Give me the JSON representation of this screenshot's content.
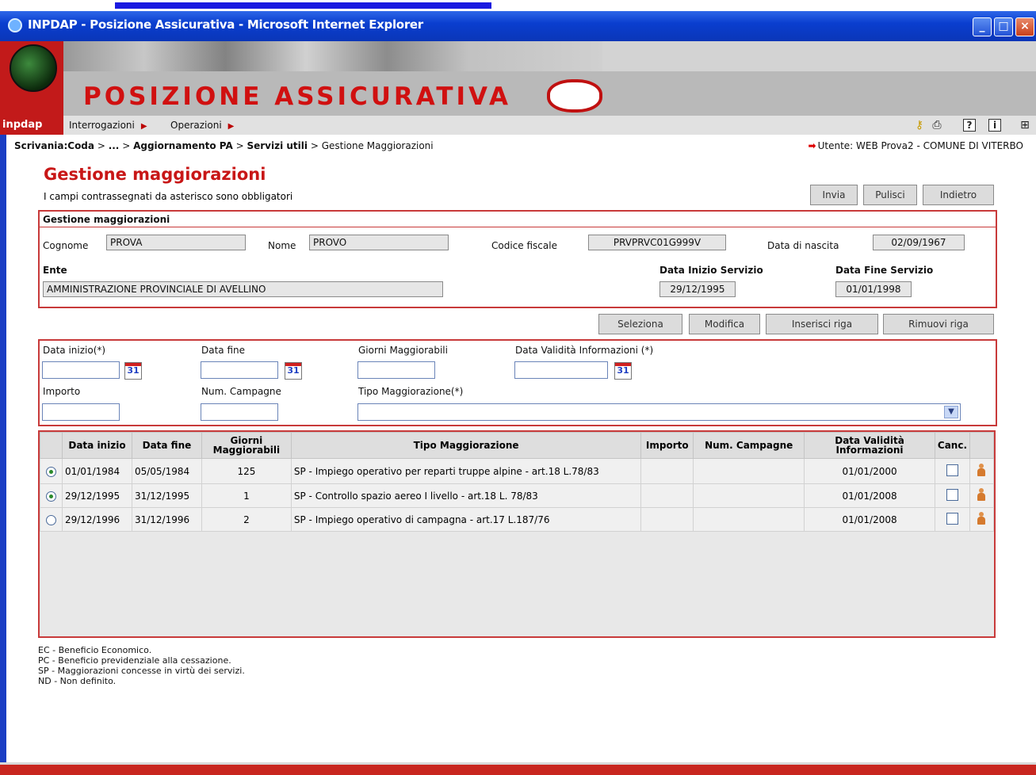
{
  "window": {
    "title": "INPDAP - Posizione Assicurativa - Microsoft Internet Explorer"
  },
  "banner": {
    "title": "POSIZIONE ASSICURATIVA",
    "logo_text": "inpdap"
  },
  "menu": {
    "items": [
      "Interrogazioni",
      "Operazioni"
    ]
  },
  "toolbar": {
    "icons": [
      "key-icon",
      "printer-icon",
      "help-icon",
      "info-icon",
      "sitemap-icon"
    ],
    "help": "?",
    "info": "i"
  },
  "breadcrumb": {
    "b1": "Scrivania:Coda",
    "sep": " > ",
    "b2": "...",
    "b3": "Aggiornamento PA",
    "b4": "Servizi utili",
    "b5": "Gestione Maggiorazioni"
  },
  "user": {
    "text": "Utente: WEB Prova2 - COMUNE DI VITERBO"
  },
  "page": {
    "title": "Gestione maggiorazioni",
    "subtitle": "I campi contrassegnati da asterisco sono obbligatori"
  },
  "actions": {
    "send": "Invia",
    "clear": "Pulisci",
    "back": "Indietro"
  },
  "anagrafica": {
    "section_title": "Gestione maggiorazioni",
    "cognome_label": "Cognome",
    "cognome": "PROVA",
    "nome_label": "Nome",
    "nome": "PROVO",
    "cf_label": "Codice fiscale",
    "cf": "PRVPRVC01G999V",
    "nascita_label": "Data di nascita",
    "nascita": "02/09/1967",
    "ente_label": "Ente",
    "ente": "AMMINISTRAZIONE PROVINCIALE DI AVELLINO",
    "inizio_label": "Data Inizio Servizio",
    "inizio": "29/12/1995",
    "fine_label": "Data Fine Servizio",
    "fine": "01/01/1998"
  },
  "row_actions": {
    "select": "Seleziona",
    "edit": "Modifica",
    "insert": "Inserisci riga",
    "remove": "Rimuovi riga"
  },
  "form": {
    "data_inizio": "Data inizio(*)",
    "data_fine": "Data fine",
    "giorni": "Giorni Maggiorabili",
    "validita": "Data Validità Informazioni (*)",
    "importo": "Importo",
    "campagne": "Num. Campagne",
    "tipo": "Tipo Maggiorazione(*)",
    "cal_label": "31"
  },
  "table": {
    "headers": [
      "Data inizio",
      "Data fine",
      "Giorni Maggiorabili",
      "Tipo Maggiorazione",
      "Importo",
      "Num. Campagne",
      "Data Validità Informazioni",
      "Canc."
    ],
    "rows": [
      {
        "selected": true,
        "inizio": "01/01/1984",
        "fine": "05/05/1984",
        "giorni": "125",
        "tipo": "SP - Impiego operativo per reparti truppe alpine - art.18 L.78/83",
        "importo": "",
        "campagne": "",
        "validita": "01/01/2000"
      },
      {
        "selected": true,
        "inizio": "29/12/1995",
        "fine": "31/12/1995",
        "giorni": "1",
        "tipo": "SP - Controllo spazio aereo I livello - art.18 L. 78/83",
        "importo": "",
        "campagne": "",
        "validita": "01/01/2008"
      },
      {
        "selected": false,
        "inizio": "29/12/1996",
        "fine": "31/12/1996",
        "giorni": "2",
        "tipo": "SP - Impiego operativo di campagna - art.17 L.187/76",
        "importo": "",
        "campagne": "",
        "validita": "01/01/2008"
      }
    ]
  },
  "legend": [
    "EC - Beneficio Economico.",
    "PC - Beneficio previdenziale alla cessazione.",
    "SP - Maggiorazioni concesse in virtù dei servizi.",
    "ND - Non definito."
  ],
  "colors": {
    "accent": "#c81717",
    "titlebar": "#0a3ecf",
    "border": "#c83a3a"
  }
}
